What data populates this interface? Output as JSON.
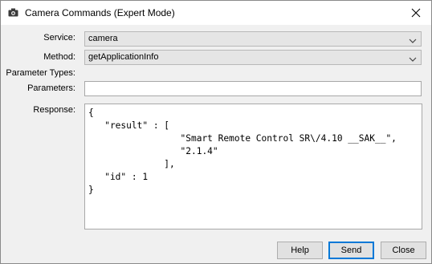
{
  "window": {
    "title": "Camera Commands (Expert Mode)",
    "title_icon": "camera-icon",
    "close_icon": "close-icon"
  },
  "form": {
    "service_label": "Service:",
    "service_value": "camera",
    "method_label": "Method:",
    "method_value": "getApplicationInfo",
    "param_types_label": "Parameter Types:",
    "parameters_label": "Parameters:",
    "parameters_value": "",
    "response_label": "Response:",
    "response_text": "{\n   \"result\" : [\n                 \"Smart Remote Control SR\\/4.10 __SAK__\",\n                 \"2.1.4\"\n              ],\n   \"id\" : 1\n}"
  },
  "buttons": {
    "help": "Help",
    "send": "Send",
    "close": "Close"
  },
  "colors": {
    "default_button_border": "#0078d7"
  }
}
